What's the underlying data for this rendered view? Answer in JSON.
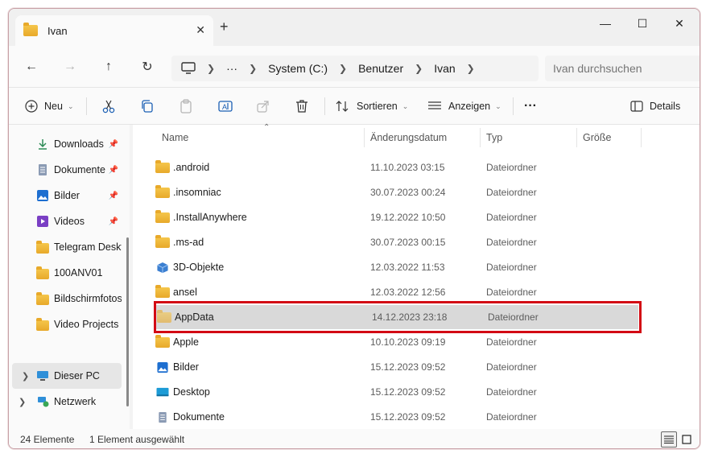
{
  "window": {
    "tab_title": "Ivan",
    "tab_close": "✕",
    "new_tab": "+",
    "minimize": "—",
    "maximize": "☐",
    "close": "✕"
  },
  "nav": {
    "back": "←",
    "forward": "→",
    "up": "↑",
    "refresh": "↻",
    "breadcrumb": [
      "System (C:)",
      "Benutzer",
      "Ivan"
    ],
    "more": "···",
    "search_placeholder": "Ivan durchsuchen"
  },
  "toolbar": {
    "new_label": "Neu",
    "sort_label": "Sortieren",
    "view_label": "Anzeigen",
    "more_label": "···",
    "details_label": "Details"
  },
  "sidebar": {
    "items": [
      {
        "label": "Downloads",
        "icon": "download-icon",
        "pinned": true
      },
      {
        "label": "Dokumente",
        "icon": "document-icon",
        "pinned": true
      },
      {
        "label": "Bilder",
        "icon": "pictures-icon",
        "pinned": true
      },
      {
        "label": "Videos",
        "icon": "videos-icon",
        "pinned": true
      },
      {
        "label": "Telegram Deskto",
        "icon": "folder-icon",
        "pinned": false
      },
      {
        "label": "100ANV01",
        "icon": "folder-icon",
        "pinned": false
      },
      {
        "label": "Bildschirmfotos",
        "icon": "folder-icon",
        "pinned": false
      },
      {
        "label": "Video Projects",
        "icon": "folder-icon",
        "pinned": false
      },
      {
        "label": "Dieser PC",
        "icon": "computer-icon",
        "pinned": false
      },
      {
        "label": "Netzwerk",
        "icon": "network-icon",
        "pinned": false
      }
    ]
  },
  "columns": {
    "name": "Name",
    "date": "Änderungsdatum",
    "type": "Typ",
    "size": "Größe"
  },
  "files": [
    {
      "name": ".android",
      "date": "11.10.2023 03:15",
      "type": "Dateiordner"
    },
    {
      "name": ".insomniac",
      "date": "30.07.2023 00:24",
      "type": "Dateiordner"
    },
    {
      "name": ".InstallAnywhere",
      "date": "19.12.2022 10:50",
      "type": "Dateiordner"
    },
    {
      "name": ".ms-ad",
      "date": "30.07.2023 00:15",
      "type": "Dateiordner"
    },
    {
      "name": "3D-Objekte",
      "date": "12.03.2022 11:53",
      "type": "Dateiordner"
    },
    {
      "name": "ansel",
      "date": "12.03.2022 12:56",
      "type": "Dateiordner"
    },
    {
      "name": "AppData",
      "date": "14.12.2023 23:18",
      "type": "Dateiordner"
    },
    {
      "name": "Apple",
      "date": "10.10.2023 09:19",
      "type": "Dateiordner"
    },
    {
      "name": "Bilder",
      "date": "15.12.2023 09:52",
      "type": "Dateiordner"
    },
    {
      "name": "Desktop",
      "date": "15.12.2023 09:52",
      "type": "Dateiordner"
    },
    {
      "name": "Dokumente",
      "date": "15.12.2023 09:52",
      "type": "Dateiordner"
    }
  ],
  "status": {
    "count": "24 Elemente",
    "selected": "1 Element ausgewählt"
  },
  "colors": {
    "highlight": "#d30b14",
    "selected_row": "#d9d9d9",
    "folder": "#f5c64b"
  }
}
